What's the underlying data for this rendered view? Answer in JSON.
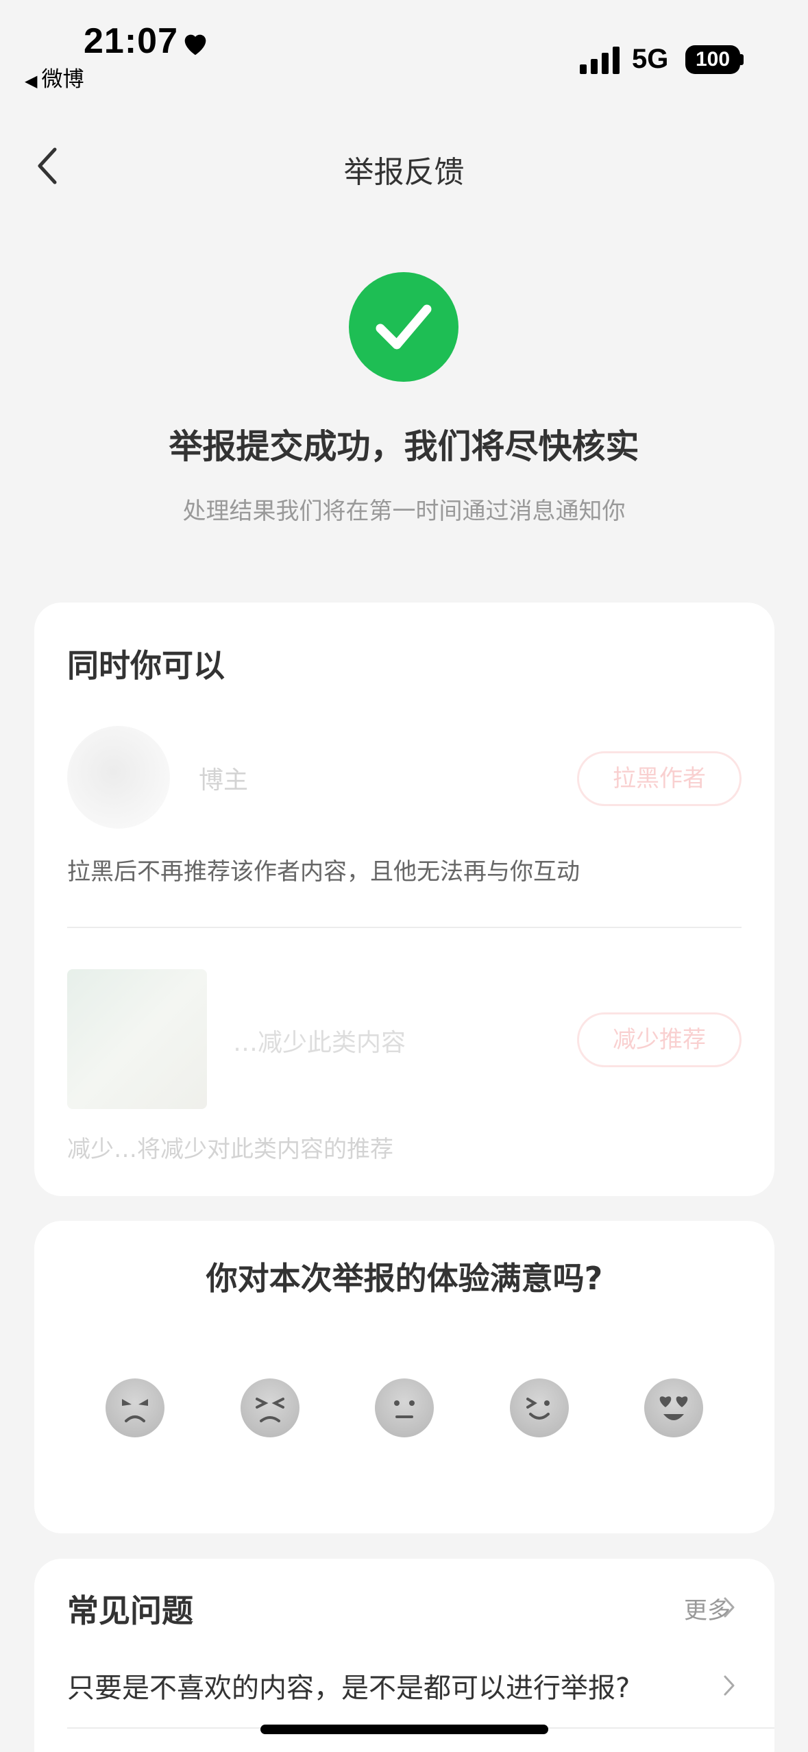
{
  "status_bar": {
    "time": "21:07",
    "back_app": "微博",
    "network": "5G",
    "battery": "100"
  },
  "nav": {
    "title": "举报反馈"
  },
  "success": {
    "title": "举报提交成功，我们将尽快核实",
    "subtitle": "处理结果我们将在第一时间通过消息通知你",
    "color": "#1ebe54"
  },
  "actions": {
    "heading": "同时你可以",
    "items": [
      {
        "name": "博主",
        "button": "拉黑作者",
        "description": "拉黑后不再推荐该作者内容，且他无法再与你互动"
      },
      {
        "name": "…减少此类内容",
        "button": "减少推荐",
        "description": "减少…将减少对此类内容的推荐"
      }
    ]
  },
  "survey": {
    "question": "你对本次举报的体验满意吗?",
    "faces": [
      "very-unsatisfied-icon",
      "unsatisfied-icon",
      "neutral-icon",
      "satisfied-icon",
      "very-satisfied-icon"
    ]
  },
  "faq": {
    "title": "常见问题",
    "more": "更多",
    "items": [
      "只要是不喜欢的内容，是不是都可以进行举报?"
    ]
  },
  "colors": {
    "accent_red": "#ec5858",
    "background": "#f4f4f4"
  }
}
